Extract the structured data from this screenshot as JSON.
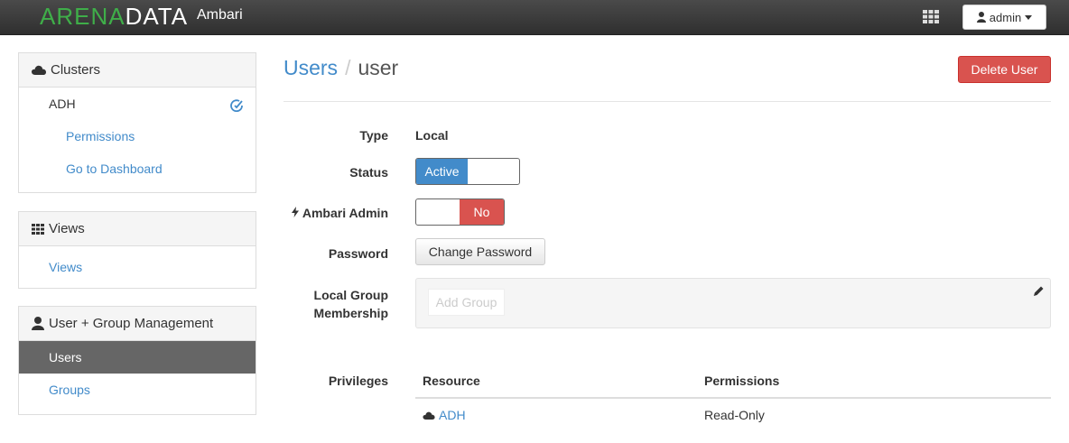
{
  "navbar": {
    "brand_part1": "ARENA",
    "brand_part2": "DATA",
    "app_name": "Ambari",
    "user_label": "admin"
  },
  "sidebar": {
    "clusters": {
      "heading": "Clusters",
      "cluster_name": "ADH",
      "items": [
        "Permissions",
        "Go to Dashboard"
      ]
    },
    "views": {
      "heading": "Views",
      "items": [
        "Views"
      ]
    },
    "user_mgmt": {
      "heading": "User + Group Management",
      "items": [
        "Users",
        "Groups"
      ],
      "active": "Users"
    }
  },
  "main": {
    "breadcrumb_parent": "Users",
    "breadcrumb_separator": "/",
    "breadcrumb_current": "user",
    "delete_button": "Delete User",
    "fields": {
      "type_label": "Type",
      "type_value": "Local",
      "status_label": "Status",
      "status_value": "Active",
      "admin_label": "Ambari Admin",
      "admin_value": "No",
      "password_label": "Password",
      "password_button": "Change Password",
      "group_label_line1": "Local Group",
      "group_label_line2": "Membership",
      "group_placeholder": "Add Group",
      "privileges_label": "Privileges"
    },
    "privileges_table": {
      "columns": [
        "Resource",
        "Permissions"
      ],
      "rows": [
        {
          "resource": "ADH",
          "permission": "Read-Only"
        }
      ]
    }
  },
  "colors": {
    "brand_green": "#3fae49",
    "link_blue": "#428bca",
    "danger_red": "#d9534f",
    "active_item_bg": "#666666"
  }
}
